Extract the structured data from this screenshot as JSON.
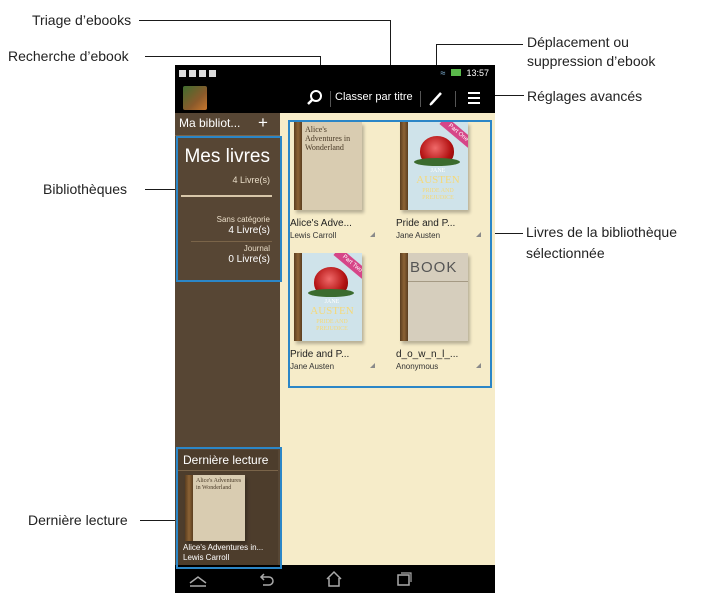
{
  "callouts": {
    "triage": "Triage d’ebooks",
    "search": "Recherche d’ebook",
    "move_delete_line1": "Déplacement ou",
    "move_delete_line2": "suppression d’ebook",
    "advanced": "Réglages avancés",
    "libraries": "Bibliothèques",
    "selected_line1": "Livres de la bibliothèque",
    "selected_line2": "sélectionnée",
    "recent": "Dernière lecture"
  },
  "status_bar": {
    "time": "13:57"
  },
  "action_bar": {
    "app_icon": "bookshelf-app-icon",
    "search_icon": "search-icon",
    "sort_label": "Classer par titre",
    "edit_icon": "pencil-icon",
    "menu_icon": "menu-icon"
  },
  "sidebar": {
    "header_title": "Ma bibliot...",
    "add_label": "+",
    "main_library": {
      "name": "Mes livres",
      "count": "4 Livre(s)"
    },
    "libraries": [
      {
        "name": "Sans catégorie",
        "count": "4 Livre(s)"
      },
      {
        "name": "Journal",
        "count": "0 Livre(s)"
      }
    ],
    "recent": {
      "title": "Dernière lecture",
      "cover_text": "Alice's Adventures in Wonderland",
      "book_title": "Alice's Adventures in...",
      "book_author": "Lewis Carroll"
    }
  },
  "books": [
    {
      "title": "Alice's Adve...",
      "author": "Lewis Carroll",
      "cover": "Alice's Adventures in Wonderland"
    },
    {
      "title": "Pride and P...",
      "author": "Jane Austen",
      "ribbon": "Part One"
    },
    {
      "title": "Pride and P...",
      "author": "Jane Austen",
      "ribbon": "Part Two"
    },
    {
      "title": "d_o_w_n_l_...",
      "author": "Anonymous",
      "cover": "BOOK"
    }
  ],
  "jane_cover": {
    "top": "JANE",
    "author": "AUSTEN",
    "subtitle1": "PRIDE AND",
    "subtitle2": "PREJUDICE"
  },
  "colors": {
    "highlight": "#2b86c7",
    "content_bg": "#f6ecc9",
    "sidebar_bg": "#574634"
  },
  "nav_bar": {
    "home_shape_icon": "up-chevron-icon",
    "back_icon": "back-icon",
    "home_icon": "home-icon",
    "recents_icon": "recent-apps-icon"
  }
}
